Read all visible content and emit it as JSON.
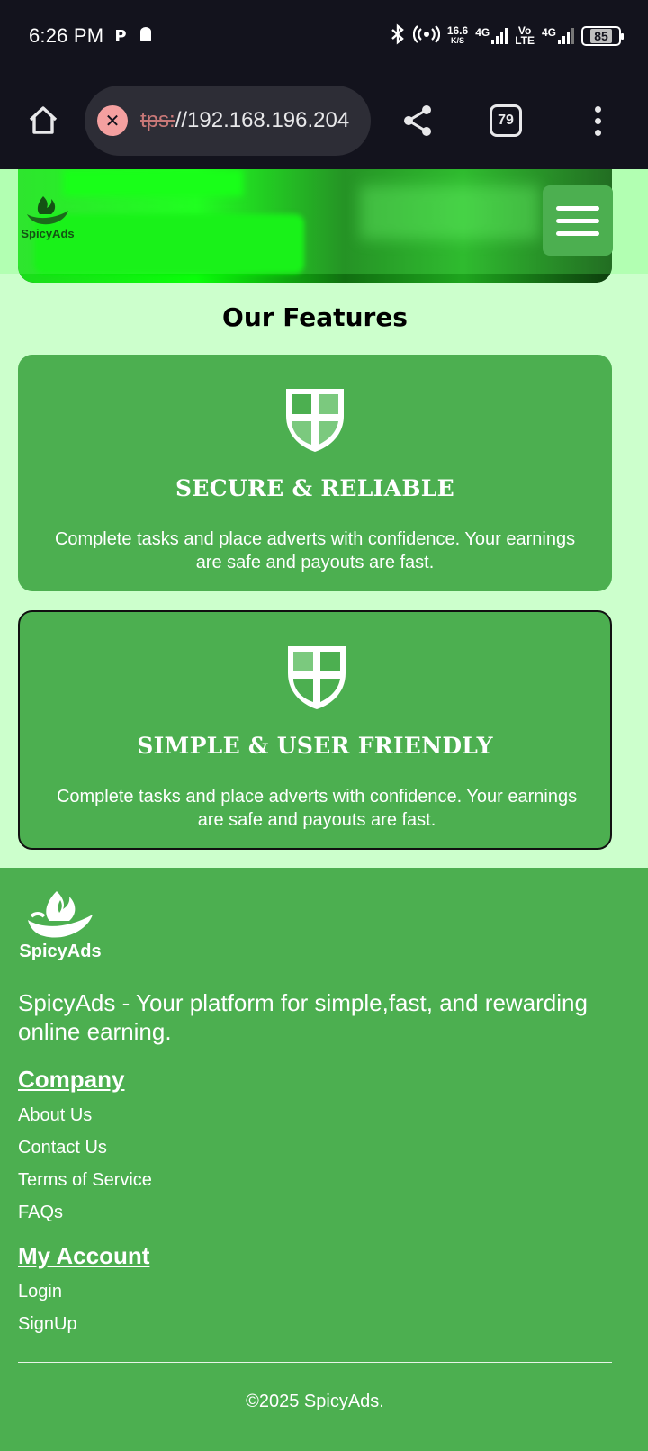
{
  "status_bar": {
    "time": "6:26 PM",
    "speed_value": "16.6",
    "speed_unit": "K/S",
    "net1": "4G",
    "volte_top": "Vo",
    "volte_bottom": "LTE",
    "net2": "4G",
    "battery": "85"
  },
  "browser": {
    "url_struck": "tps:",
    "url_rest": "//192.168.196.204",
    "tab_count": "79"
  },
  "site": {
    "brand": "SpicyAds"
  },
  "features": {
    "title": "Our Features",
    "cards": [
      {
        "title": "SECURE & RELIABLE",
        "text": "Complete tasks and place adverts with confidence. Your earnings are safe and payouts are fast."
      },
      {
        "title": "SIMPLE & USER FRIENDLY",
        "text": "Complete tasks and place adverts with confidence. Your earnings are safe and payouts are fast."
      }
    ]
  },
  "footer": {
    "brand": "SpicyAds",
    "tagline": "SpicyAds - Your platform for simple,fast, and rewarding online earning.",
    "company_heading": "Company",
    "company_links": [
      "About Us",
      "Contact Us",
      "Terms of Service",
      "FAQs"
    ],
    "account_heading": "My Account",
    "account_links": [
      "Login",
      "SignUp"
    ],
    "copyright": "©2025 SpicyAds."
  },
  "colors": {
    "page_bg": "#ccffcc",
    "brand_green": "#4caf50",
    "system_bar": "#13131d"
  }
}
